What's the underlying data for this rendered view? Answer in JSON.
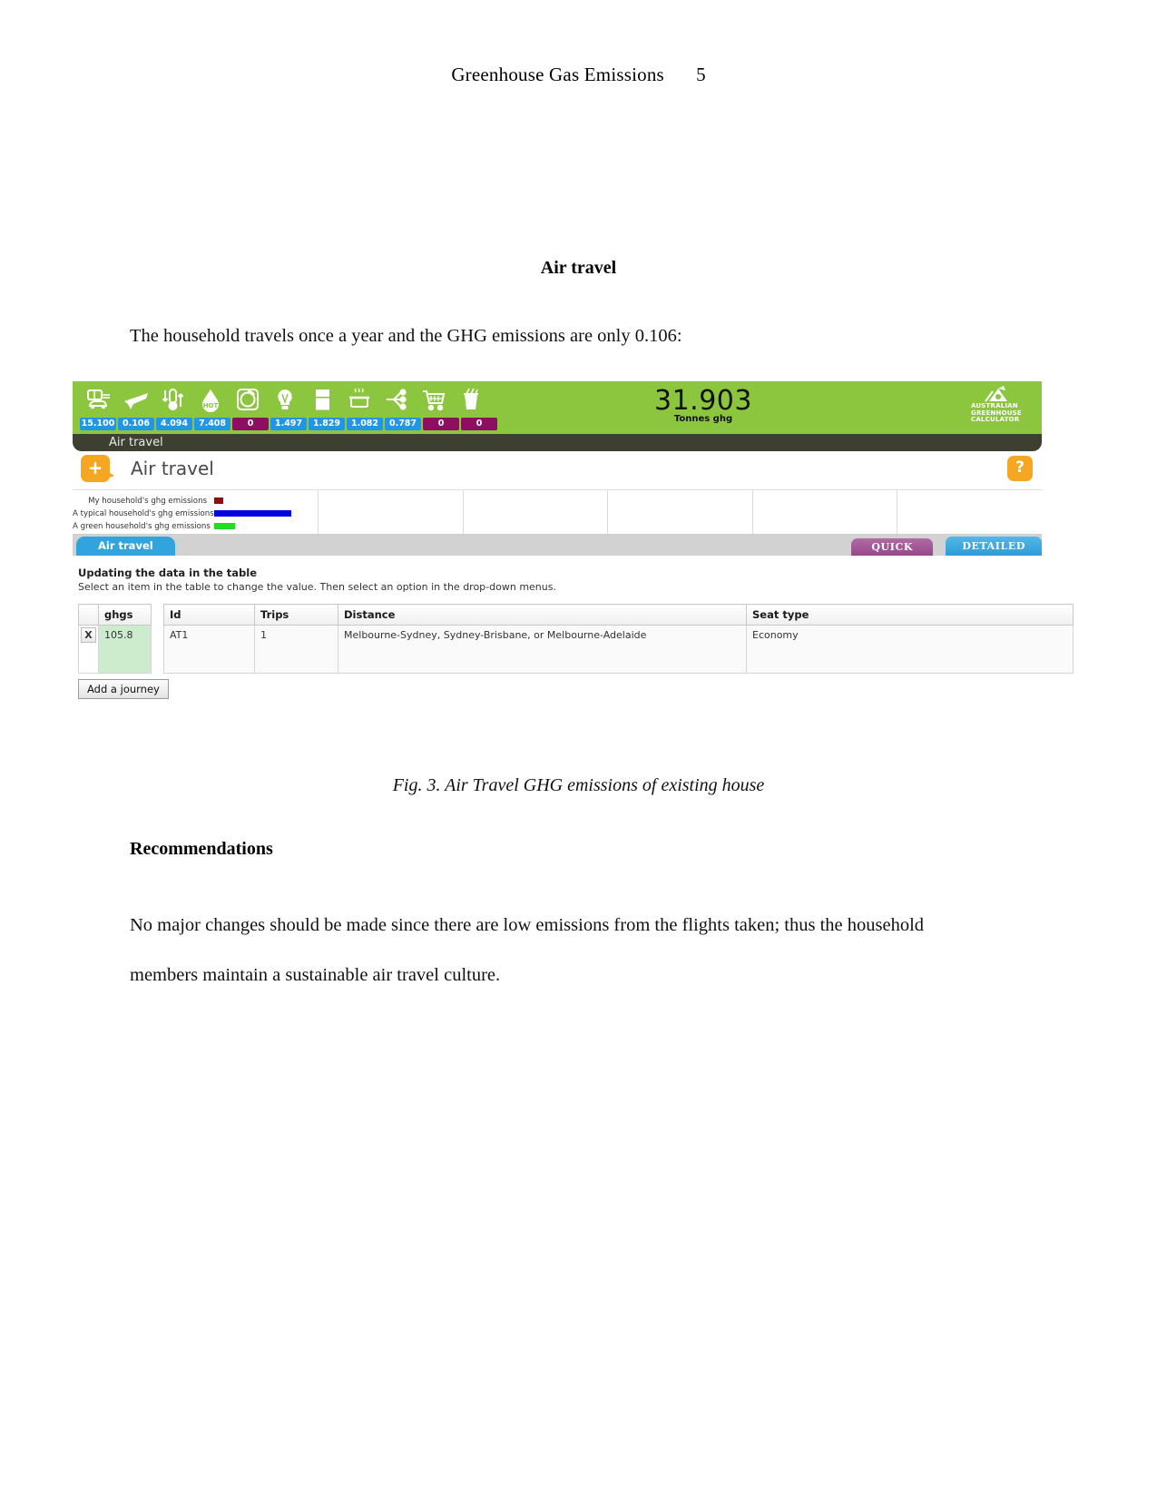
{
  "page": {
    "header_title": "Greenhouse Gas Emissions",
    "header_page_number": "5",
    "section_heading": "Air travel",
    "intro_paragraph": "The household travels once a year and the GHG emissions are only 0.106:",
    "figure_caption": "Fig. 3. Air Travel GHG emissions of existing house",
    "recommendations_heading": "Recommendations",
    "recommendations_paragraph": "No major changes should be made since there are low emissions from the flights taken; thus the household members maintain a sustainable air travel culture."
  },
  "calculator": {
    "brand": {
      "line1": "AUSTRALIAN",
      "line2": "GREENHOUSE",
      "line3": "CALCULATOR"
    },
    "total": {
      "value": "31.903",
      "unit": "Tonnes ghg"
    },
    "categories": [
      {
        "icon": "car-icon",
        "value": "15.100",
        "style": "blue"
      },
      {
        "icon": "plane-icon",
        "value": "0.106",
        "style": "blue"
      },
      {
        "icon": "thermometer-icon",
        "value": "4.094",
        "style": "blue"
      },
      {
        "icon": "hot-water-icon",
        "value": "7.408",
        "style": "blue"
      },
      {
        "icon": "washing-machine-icon",
        "value": "0",
        "style": "purple"
      },
      {
        "icon": "lightbulb-icon",
        "value": "1.497",
        "style": "blue"
      },
      {
        "icon": "fridge-icon",
        "value": "1.829",
        "style": "blue"
      },
      {
        "icon": "cooking-icon",
        "value": "1.082",
        "style": "blue"
      },
      {
        "icon": "appliances-plug-icon",
        "value": "0.787",
        "style": "blue"
      },
      {
        "icon": "shopping-trolley-icon",
        "value": "0",
        "style": "purple"
      },
      {
        "icon": "waste-bin-icon",
        "value": "0",
        "style": "purple"
      }
    ],
    "breadcrumb": "Air travel",
    "panel": {
      "add_label": "+",
      "title": "Air travel",
      "help_label": "?"
    },
    "legend": [
      {
        "label": "My household's ghg emissions",
        "color": "#8b0f0f",
        "width": 10
      },
      {
        "label": "A typical household's ghg emissions",
        "color": "#0000e6",
        "width": 85
      },
      {
        "label": "A green household's ghg emissions",
        "color": "#22dd22",
        "width": 23
      }
    ],
    "tabs": {
      "active_tab": "Air travel",
      "quick_label": "QUICK",
      "detailed_label": "DETAILED"
    },
    "instructions": {
      "title": "Updating the data in the table",
      "subtitle": "Select an item in the table to change the value. Then select an option in the drop-down menus."
    },
    "table": {
      "columns": [
        "",
        "ghgs",
        "Id",
        "Trips",
        "Distance",
        "Seat type"
      ],
      "rows": [
        {
          "remove": "X",
          "ghgs": "105.8",
          "id": "AT1",
          "trips": "1",
          "distance": "Melbourne-Sydney, Sydney-Brisbane, or Melbourne-Adelaide",
          "seat_type": "Economy"
        }
      ]
    },
    "add_journey_label": "Add a journey"
  }
}
